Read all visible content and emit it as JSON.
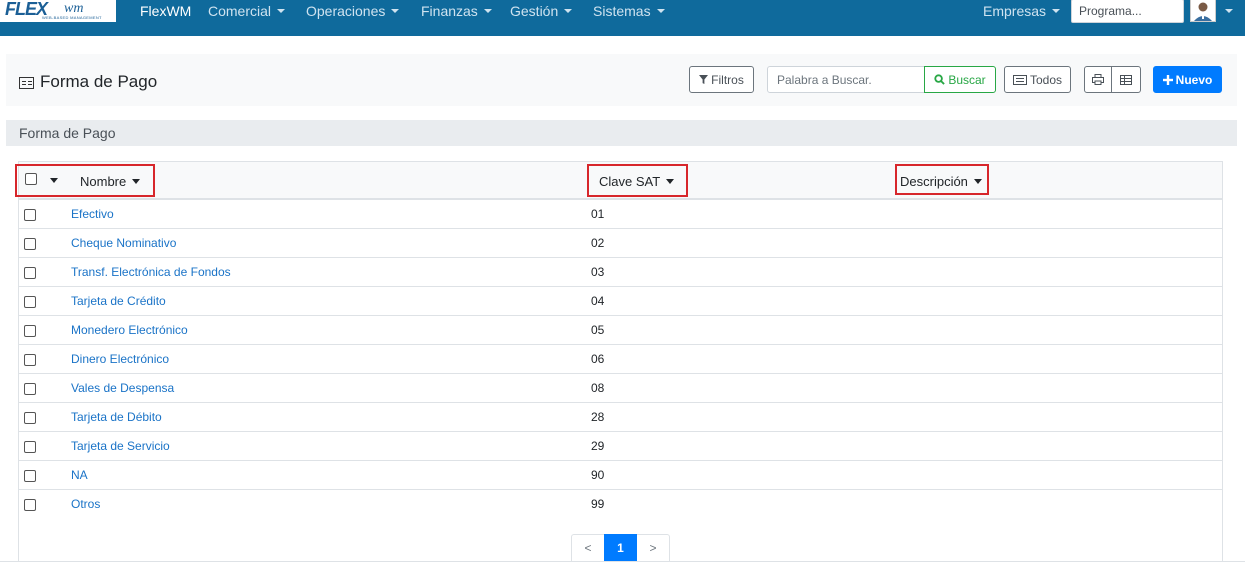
{
  "navbar": {
    "logo_flex": "FLEX",
    "logo_wm": "wm",
    "logo_sub": "WEB-BASED MANAGEMENT",
    "brand": "FlexWM",
    "menus": [
      "Comercial",
      "Operaciones",
      "Finanzas",
      "Gestión",
      "Sistemas"
    ],
    "empresas": "Empresas",
    "program_search": "Programa..."
  },
  "header": {
    "title": "Forma de Pago",
    "filtros_label": "Filtros",
    "search_placeholder": "Palabra a Buscar.",
    "buscar_label": "Buscar",
    "todos_label": "Todos",
    "nuevo_label": "Nuevo"
  },
  "section": {
    "label": "Forma de Pago"
  },
  "table": {
    "columns": [
      "Nombre",
      "Clave SAT",
      "Descripción"
    ],
    "rows": [
      {
        "nombre": "Efectivo",
        "clave": "01"
      },
      {
        "nombre": "Cheque Nominativo",
        "clave": "02"
      },
      {
        "nombre": "Transf. Electrónica de Fondos",
        "clave": "03"
      },
      {
        "nombre": "Tarjeta de Crédito",
        "clave": "04"
      },
      {
        "nombre": "Monedero Electrónico",
        "clave": "05"
      },
      {
        "nombre": "Dinero Electrónico",
        "clave": "06"
      },
      {
        "nombre": "Vales de Despensa",
        "clave": "08"
      },
      {
        "nombre": "Tarjeta de Débito",
        "clave": "28"
      },
      {
        "nombre": "Tarjeta de Servicio",
        "clave": "29"
      },
      {
        "nombre": "NA",
        "clave": "90"
      },
      {
        "nombre": "Otros",
        "clave": "99"
      }
    ]
  },
  "pagination": {
    "prev": "<",
    "current": "1",
    "next": ">"
  },
  "colors": {
    "navbar_bg": "#0f6a9c",
    "link": "#1a73c7",
    "primary": "#007bff",
    "success": "#28a745",
    "highlight": "#d7262b"
  },
  "icons": {
    "title": "table-list-icon",
    "filtros": "filter-icon",
    "buscar": "search-icon",
    "todos": "list-icon",
    "print": "print-icon",
    "grid": "grid-icon",
    "nuevo": "plus-icon",
    "user": "user-avatar-icon"
  }
}
